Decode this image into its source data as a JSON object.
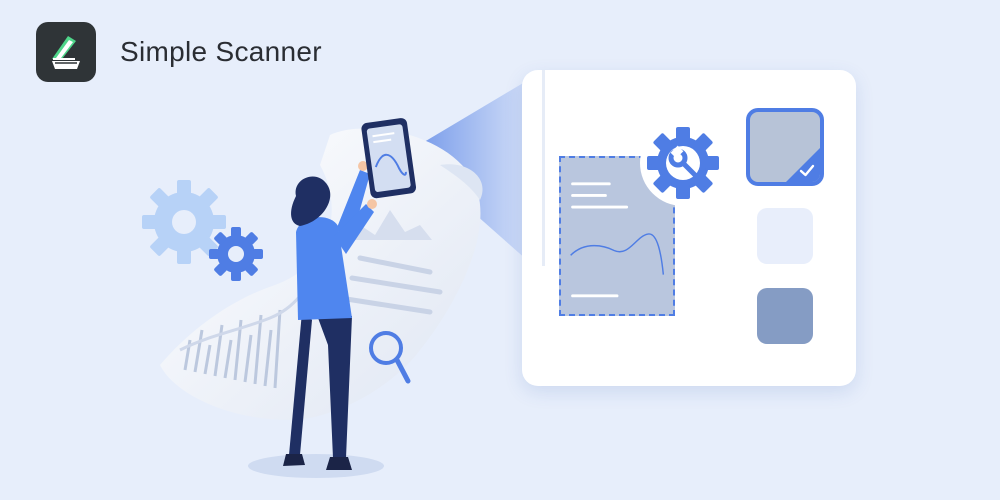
{
  "app": {
    "name": "Simple Scanner",
    "logo_icon": "scanner-icon"
  },
  "colors": {
    "background": "#e7eefb",
    "accent": "#4f7de4",
    "card": "#ffffff",
    "doc_fill": "#b9c6de",
    "swatch_selected": "#b7c3d7",
    "swatch_light": "#e8eefb",
    "swatch_dark": "#859cc4",
    "figure_shirt": "#4f86ef",
    "figure_pants": "#1f2f63"
  },
  "illustration": {
    "icons": [
      "gear-icon",
      "magnifier-icon",
      "tablet-icon",
      "settings-wrench-icon",
      "checkmark-icon"
    ]
  }
}
